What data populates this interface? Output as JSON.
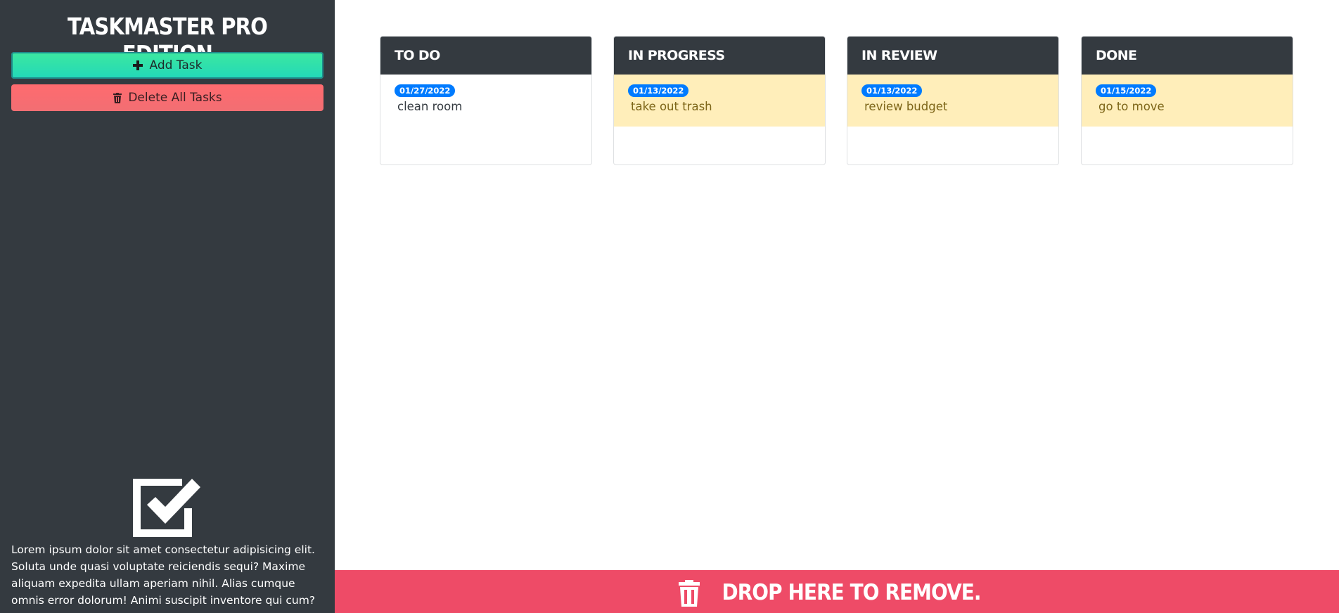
{
  "sidebar": {
    "title": "TASKMASTER PRO EDITION",
    "add_label": "Add Task",
    "delete_label": "Delete All Tasks",
    "about": "Lorem ipsum dolor sit amet consectetur adipisicing elit. Soluta unde quasi voluptate reiciendis sequi? Maxime aliquam expedita ullam aperiam nihil. Alias cumque omnis error dolorum! Animi suscipit inventore qui cum?"
  },
  "columns": [
    {
      "title": "TO DO",
      "tasks": [
        {
          "date": "01/27/2022",
          "text": "clean room",
          "highlight": false
        }
      ]
    },
    {
      "title": "IN PROGRESS",
      "tasks": [
        {
          "date": "01/13/2022",
          "text": "take out trash",
          "highlight": true
        }
      ]
    },
    {
      "title": "IN REVIEW",
      "tasks": [
        {
          "date": "01/13/2022",
          "text": "review budget",
          "highlight": true
        }
      ]
    },
    {
      "title": "DONE",
      "tasks": [
        {
          "date": "01/15/2022",
          "text": "go to move",
          "highlight": true
        }
      ]
    }
  ],
  "dropzone": {
    "label": "DROP HERE TO REMOVE."
  },
  "icons": {
    "add": "plus-icon",
    "delete": "trash-icon",
    "logo": "checkbox-icon",
    "drop": "trash-icon"
  },
  "colors": {
    "sidebar": "#343a40",
    "add_button": "#2fe0ab",
    "delete_button": "#ff6b6f",
    "badge": "#007bff",
    "highlight": "#ffeeba",
    "dropzone": "#ee4b67"
  }
}
